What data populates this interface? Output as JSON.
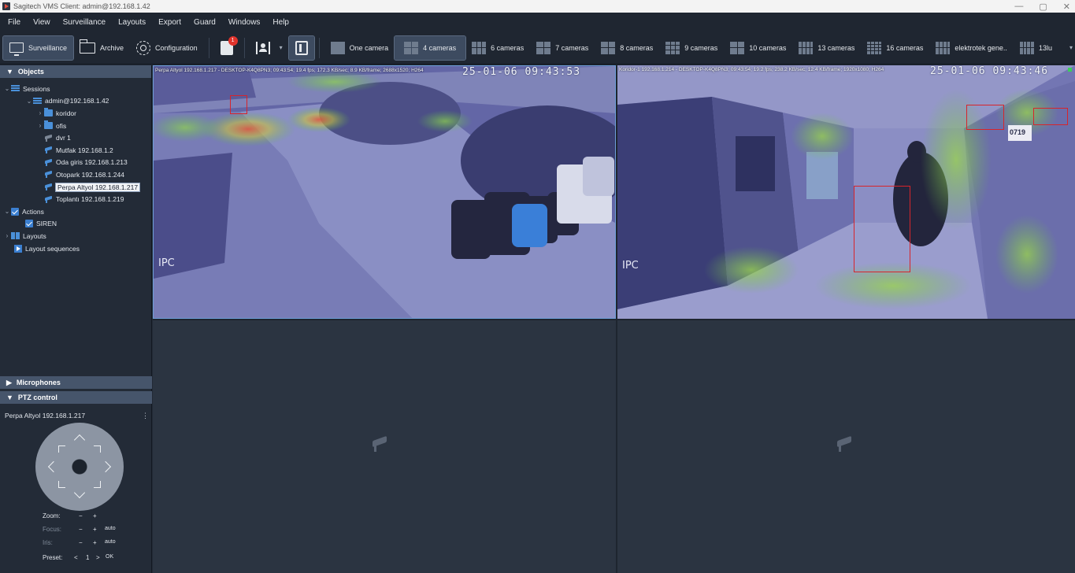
{
  "window": {
    "title": "Sagitech VMS Client: admin@192.168.1.42",
    "minimize": "—",
    "restore": "▢",
    "close": "✕"
  },
  "menu": [
    "File",
    "View",
    "Surveillance",
    "Layouts",
    "Export",
    "Guard",
    "Windows",
    "Help"
  ],
  "toolbar": {
    "surveillance": "Surveillance",
    "archive": "Archive",
    "configuration": "Configuration",
    "notifications_badge": "1",
    "layouts": {
      "one": "One camera",
      "four": "4 cameras",
      "six": "6 cameras",
      "seven": "7 cameras",
      "eight": "8 cameras",
      "nine": "9 cameras",
      "ten": "10 cameras",
      "thirteen": "13 cameras",
      "sixteen": "16 cameras",
      "custom1": "elektrotek gene..",
      "custom2": "13lu"
    }
  },
  "objects_panel": {
    "title": "Objects",
    "sessions": "Sessions",
    "server": "admin@192.168.1.42",
    "folder_koridor": "koridor",
    "folder_ofis": "ofis",
    "cam_dvr": "dvr 1",
    "cam_mutfak": "Mutfak 192.168.1.2",
    "cam_oda": "Oda giris 192.168.1.213",
    "cam_otopark": "Otopark 192.168.1.244",
    "cam_perpa": "Perpa Altyol 192.168.1.217",
    "cam_toplanti": "Toplantı 192.168.1.219",
    "actions": "Actions",
    "siren": "SIREN",
    "layouts": "Layouts",
    "layout_sequences": "Layout sequences"
  },
  "microphones": {
    "title": "Microphones"
  },
  "ptz": {
    "title": "PTZ control",
    "camera": "Perpa Altyol 192.168.1.217",
    "menu": "⋮",
    "zoom_label": "Zoom:",
    "focus_label": "Focus:",
    "iris_label": "Iris:",
    "preset_label": "Preset:",
    "minus": "−",
    "plus": "+",
    "auto": "auto",
    "preset_prev": "<",
    "preset_value": "1",
    "preset_next": ">",
    "preset_ok": "OK"
  },
  "cameras": {
    "cam1": {
      "info": "Perpa Altyol 192.168.1.217 - DESKTOP-K4Q8PN3; 09:43:54; 19.4 fps; 172.3 KB/sec; 8.9 KB/frame; 2688x1520; H264",
      "timestamp": "25-01-06 09:43:53",
      "osd": "IPC"
    },
    "cam2": {
      "info": "Koridor-1 192.168.1.214 - DESKTOP-K4Q8PN3; 09:43:54; 19.2 fps; 238.2 KB/sec; 12.4 KB/frame; 1920x1080; H264",
      "timestamp": "25-01-06 09:43:46",
      "osd": "IPC",
      "sign": "0719"
    }
  },
  "colors": {
    "accent": "#3b7fd0",
    "detection": "#d7242b",
    "badge": "#e0332c",
    "panel_header": "#46556b"
  }
}
